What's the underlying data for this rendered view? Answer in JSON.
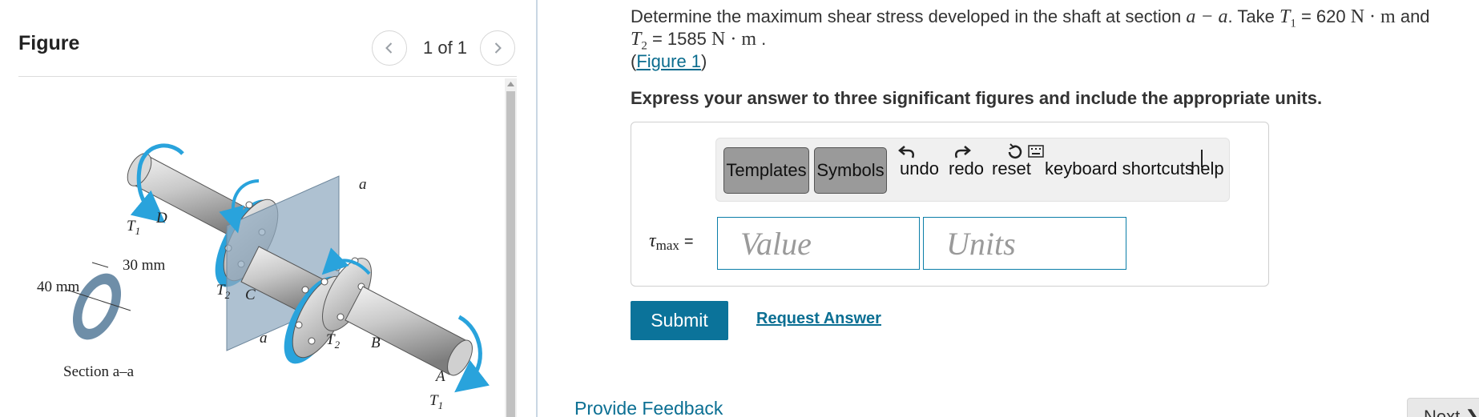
{
  "figure_panel": {
    "title": "Figure",
    "pager_text": "1 of 1",
    "labels": {
      "t1_left": "T",
      "t1_left_sub": "1",
      "d": "D",
      "a_top": "a",
      "mm30": "30 mm",
      "mm40": "40 mm",
      "t2_left": "T",
      "t2_left_sub": "2",
      "c": "C",
      "a_bottom": "a",
      "t2_right": "T",
      "t2_right_sub": "2",
      "b": "B",
      "section": "Section a–a",
      "a_end": "A",
      "t1_bottom": "T",
      "t1_bottom_sub": "1"
    }
  },
  "question": {
    "line1_text": "Determine the maximum shear stress developed in the shaft at section ",
    "section_symbol": "a − a",
    "take_text": ". Take ",
    "t1_symbol": "T",
    "t1_sub": "1",
    "t1_value": " = 620 ",
    "t1_unit": "N · m",
    "and_text": " and",
    "t2_symbol": "T",
    "t2_sub": "2",
    "t2_value": " = 1585 ",
    "t2_unit": "N · m",
    "period": " .",
    "figure_link": "Figure 1",
    "paren_open": "(",
    "paren_close": ")",
    "instruction": "Express your answer to three significant figures and include the appropriate units."
  },
  "toolbar": {
    "templates_label": "Templates",
    "symbols_label": "Symbols",
    "undo_label": "undo",
    "redo_label": "redo",
    "reset_label": "reset",
    "shortcuts_label": "keyboard shortcuts",
    "help_label": "help"
  },
  "answer": {
    "tau_symbol": "τ",
    "tau_sub": "max",
    "equals": "=",
    "value_placeholder": "Value",
    "units_placeholder": "Units"
  },
  "actions": {
    "submit_label": "Submit",
    "request_label": "Request Answer",
    "feedback_label": "Provide Feedback",
    "next_label": "Next ❯"
  },
  "colors": {
    "accent": "#0b739a",
    "link": "#0b6f93",
    "torque_arrow": "#29a3dc",
    "section_plane": "#8fa9bf"
  }
}
